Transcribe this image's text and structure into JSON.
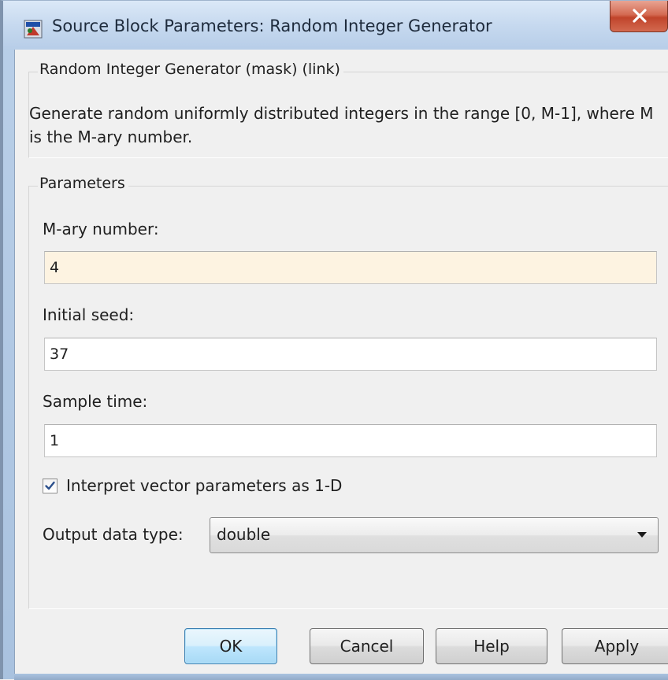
{
  "window": {
    "title": "Source Block Parameters: Random Integer Generator",
    "close_glyph": "X"
  },
  "block_group": {
    "title": "Random Integer Generator (mask) (link)",
    "description": "Generate random uniformly distributed integers in the range [0, M-1], where M is the M-ary number."
  },
  "parameters": {
    "title": "Parameters",
    "mary_label": "M-ary number:",
    "mary_value": "4",
    "seed_label": "Initial seed:",
    "seed_value": "37",
    "sample_label": "Sample time:",
    "sample_value": "1",
    "interpret_label": "Interpret vector parameters as 1-D",
    "interpret_checked": true,
    "output_type_label": "Output data type:",
    "output_type_value": "double"
  },
  "buttons": {
    "ok": "OK",
    "cancel": "Cancel",
    "help": "Help",
    "apply": "Apply"
  },
  "colors": {
    "edited_field_bg": "#fdf3e1",
    "default_button_border": "#3c7fb1",
    "close_button": "#c0442b"
  }
}
